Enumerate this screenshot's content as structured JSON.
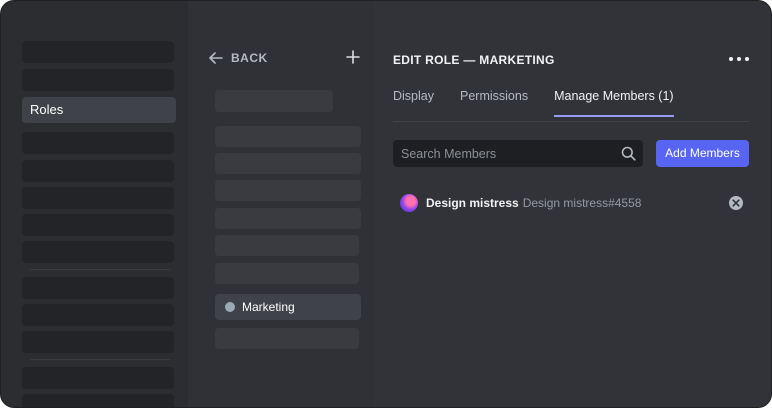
{
  "sidebar": {
    "active_item": "Roles"
  },
  "roles_panel": {
    "back_label": "BACK",
    "add_icon": "plus-icon",
    "active_role": {
      "name": "Marketing",
      "color": "#99aab5"
    }
  },
  "editor": {
    "title": "EDIT ROLE — MARKETING",
    "tabs": [
      {
        "label": "Display",
        "active": false
      },
      {
        "label": "Permissions",
        "active": false
      },
      {
        "label": "Manage Members (1)",
        "active": true
      }
    ],
    "search": {
      "placeholder": "Search Members",
      "value": ""
    },
    "add_button_label": "Add Members",
    "members": [
      {
        "display_name": "Design mistress",
        "tag": "Design mistress#4558"
      }
    ]
  },
  "colors": {
    "accent": "#5865f2",
    "tab_underline": "#949cf7"
  }
}
